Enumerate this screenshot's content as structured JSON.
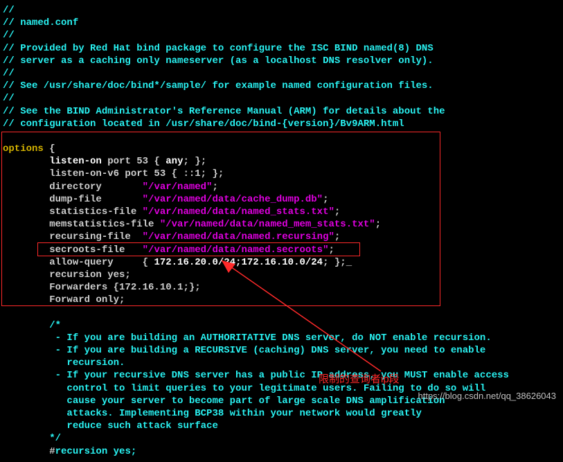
{
  "header": {
    "l1": "//",
    "l2": "// named.conf",
    "l3": "//",
    "l4a": "// Provided by ",
    "l4b": "Red Hat",
    "l4c": " bind package to configure the ISC BIND named(8) DNS",
    "l5": "// server as a caching only nameserver (as a localhost DNS resolver only).",
    "l6": "//",
    "l7": "// See /usr/share/doc/bind*/sample/ for example named configuration files.",
    "l8": "//",
    "l9": "// See the BIND Administrator's Reference Manual (ARM) for details about the",
    "l10": "// configuration located in /usr/share/doc/bind-{version}/Bv9ARM.html"
  },
  "options": {
    "kw": "options",
    "brace": " {",
    "listen_on_a": "        ",
    "listen_on_b": "listen-on",
    "listen_on_c": " port 53 { ",
    "listen_on_d": "any",
    "listen_on_e": "; };",
    "listen_v6": "        listen-on-v6 port 53 { ::1; };",
    "dir_a": "        directory       ",
    "dir_b": "\"/var/named\"",
    "dir_c": ";",
    "dump_a": "        dump-file       ",
    "dump_b": "\"/var/named/data/cache_dump.db\"",
    "dump_c": ";",
    "stats_a": "        statistics-file ",
    "stats_b": "\"/var/named/data/named_stats.txt\"",
    "stats_c": ";",
    "mem_a": "        memstatistics-file ",
    "mem_b": "\"/var/named/data/named_mem_stats.txt\"",
    "mem_c": ";",
    "rec_a": "        recursing-file  ",
    "rec_b": "\"/var/named/data/named.recursing\"",
    "rec_c": ";",
    "sec_a": "        secroots-file   ",
    "sec_b": "\"/var/named/data/named.secroots\"",
    "sec_c": ";",
    "allow_a": "        allow-query     { ",
    "allow_b": "172.16.20.0/24;172.16.10.0/24",
    "allow_c": "; };",
    "cursor": "_",
    "recursion": "        recursion yes;",
    "fwd": "        Forwarders {172.16.10.1;};",
    "fwdonly": "        Forward only;",
    "blank": "",
    "cstart": "        /*"
  },
  "comments": {
    "c1": "         - If you are building an AUTHORITATIVE DNS server, do NOT enable recursion.",
    "c2": "         - If you are building a RECURSIVE (caching) DNS server, you need to enable",
    "c3": "           recursion.",
    "c4": "         - If your recursive DNS server has a public IP address, you MUST enable access",
    "c5": "           control to limit queries to your legitimate users. Failing to do so will",
    "c6": "           cause your server to become part of large scale DNS amplification",
    "c7": "           attacks. Implementing BCP38 within your network would greatly",
    "c8": "           reduce such attack surface",
    "c9": "        */",
    "c10a": "        #",
    "c10b": "recursion yes;"
  },
  "annotation": "限制的查询者ip段",
  "watermark": "https://blog.csdn.net/qq_38626043"
}
